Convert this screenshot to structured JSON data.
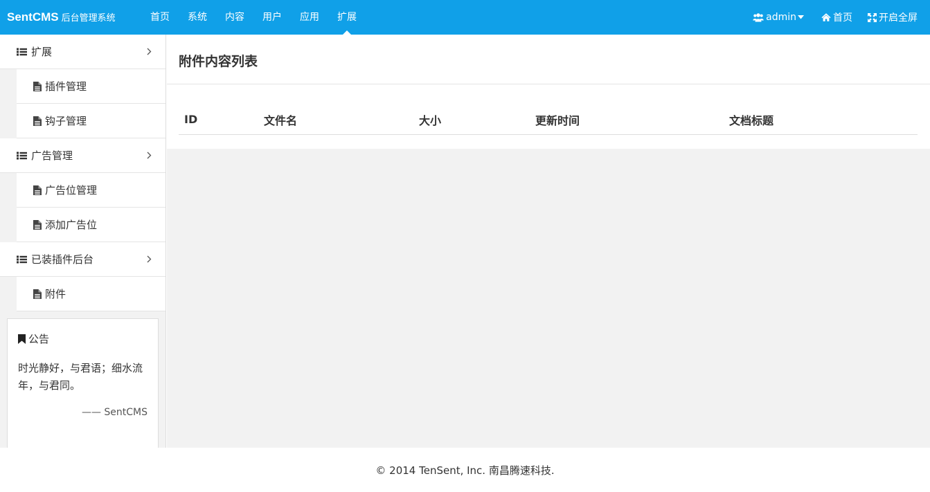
{
  "brand": {
    "name": "SentCMS",
    "subtitle": "后台管理系统"
  },
  "nav": {
    "items": [
      {
        "label": "首页"
      },
      {
        "label": "系统"
      },
      {
        "label": "内容"
      },
      {
        "label": "用户"
      },
      {
        "label": "应用"
      },
      {
        "label": "扩展",
        "active": true
      }
    ],
    "user": "admin",
    "home": "首页",
    "fullscreen": "开启全屏"
  },
  "sidebar": {
    "groups": [
      {
        "label": "扩展",
        "items": [
          "插件管理",
          "钩子管理"
        ]
      },
      {
        "label": "广告管理",
        "items": [
          "广告位管理",
          "添加广告位"
        ]
      },
      {
        "label": "已装插件后台",
        "items": [
          "附件"
        ]
      }
    ],
    "notice": {
      "title": "公告",
      "body": "时光静好，与君语；细水流年，与君同。",
      "sign": "—— SentCMS"
    }
  },
  "main": {
    "title": "附件内容列表",
    "columns": [
      "ID",
      "文件名",
      "大小",
      "更新时间",
      "文档标题"
    ]
  },
  "footer": {
    "text": "© 2014 TenSent, Inc. 南昌腾速科技."
  },
  "colors": {
    "header": "#10a0e8",
    "background": "#f2f2f2"
  }
}
